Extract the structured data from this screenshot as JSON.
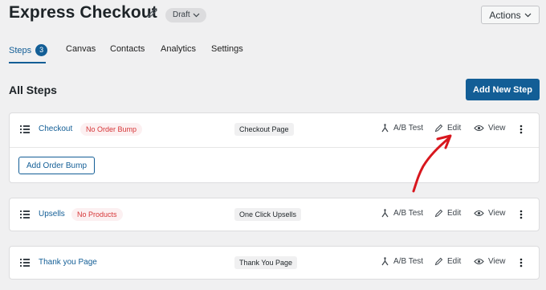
{
  "header": {
    "title": "Express Checkout",
    "status_badge": "Draft",
    "actions_label": "Actions"
  },
  "tabs": [
    {
      "label": "Steps",
      "count": "3",
      "active": true
    },
    {
      "label": "Canvas"
    },
    {
      "label": "Contacts"
    },
    {
      "label": "Analytics"
    },
    {
      "label": "Settings"
    }
  ],
  "section": {
    "title": "All Steps",
    "add_button": "Add New Step"
  },
  "steps": [
    {
      "name": "Checkout",
      "badge": "No Order Bump",
      "type": "Checkout Page",
      "sub_action": "Add Order Bump"
    },
    {
      "name": "Upsells",
      "badge": "No Products",
      "type": "One Click Upsells"
    },
    {
      "name": "Thank you Page",
      "type": "Thank You Page"
    }
  ],
  "step_actions": {
    "ab_test": "A/B Test",
    "edit": "Edit",
    "view": "View"
  },
  "colors": {
    "primary": "#135e96",
    "warning_text": "#d63638",
    "warning_bg": "#fcf0f1",
    "annotation": "#d8171e"
  },
  "icons": [
    "pencil-icon",
    "chevron-down-icon",
    "drag-handle-icon",
    "ab-test-icon",
    "eye-icon",
    "kebab-menu-icon"
  ]
}
